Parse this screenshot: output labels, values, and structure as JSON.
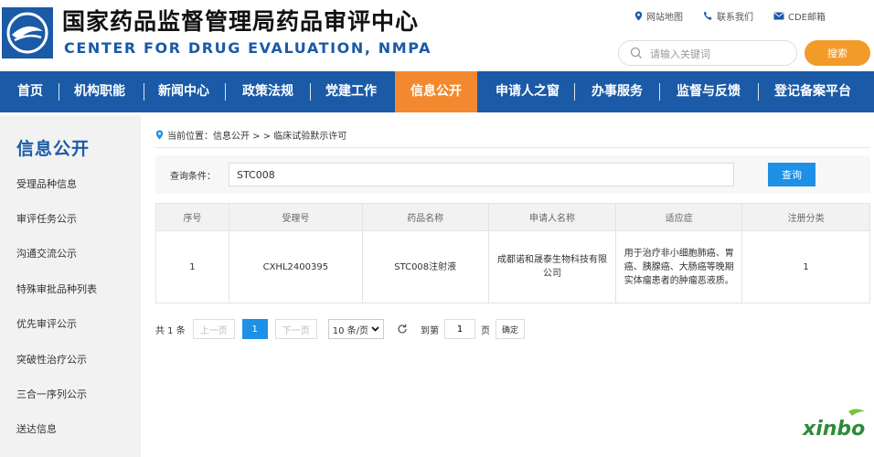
{
  "header": {
    "title_cn": "国家药品监督管理局药品审评中心",
    "title_en": "CENTER FOR DRUG EVALUATION, NMPA",
    "links": [
      {
        "label": "网站地图",
        "icon": "location-pin-icon"
      },
      {
        "label": "联系我们",
        "icon": "phone-icon"
      },
      {
        "label": "CDE邮箱",
        "icon": "mail-icon"
      }
    ],
    "search_placeholder": "请输入关键词",
    "search_button": "搜索"
  },
  "nav": {
    "items": [
      {
        "label": "首页"
      },
      {
        "label": "机构职能"
      },
      {
        "label": "新闻中心"
      },
      {
        "label": "政策法规"
      },
      {
        "label": "党建工作"
      },
      {
        "label": "信息公开",
        "active": true
      },
      {
        "label": "申请人之窗"
      },
      {
        "label": "办事服务"
      },
      {
        "label": "监督与反馈"
      },
      {
        "label": "登记备案平台"
      }
    ]
  },
  "sidebar": {
    "title": "信息公开",
    "items": [
      {
        "label": "受理品种信息"
      },
      {
        "label": "审评任务公示"
      },
      {
        "label": "沟通交流公示"
      },
      {
        "label": "特殊审批品种列表"
      },
      {
        "label": "优先审评公示"
      },
      {
        "label": "突破性治疗公示"
      },
      {
        "label": "三合一序列公示"
      },
      {
        "label": "送达信息"
      }
    ]
  },
  "breadcrumb": "当前位置：信息公开 > > 临床试验默示许可",
  "query": {
    "label": "查询条件：",
    "value": "STC008",
    "button": "查询"
  },
  "table": {
    "columns": [
      "序号",
      "受理号",
      "药品名称",
      "申请人名称",
      "适应症",
      "注册分类"
    ],
    "rows": [
      [
        "1",
        "CXHL2400395",
        "STC008注射液",
        "成都诺和晟泰生物科技有限公司",
        "用于治疗非小细胞肺癌、胃癌、胰腺癌、大肠癌等晚期实体瘤患者的肿瘤恶液质。",
        "1"
      ]
    ]
  },
  "pager": {
    "total": "共 1 条",
    "prev": "上一页",
    "current": "1",
    "next": "下一页",
    "page_size": "10 条/页",
    "goto_label": "到第",
    "goto_value": "1",
    "page_unit": "页",
    "confirm": "确定"
  },
  "watermark": "xinbo",
  "colors": {
    "brand_blue": "#1a5aa7",
    "active_orange": "#f3892e",
    "search_orange": "#f39b29",
    "button_blue": "#1e90e6",
    "watermark_green": "#2e8b3a"
  }
}
